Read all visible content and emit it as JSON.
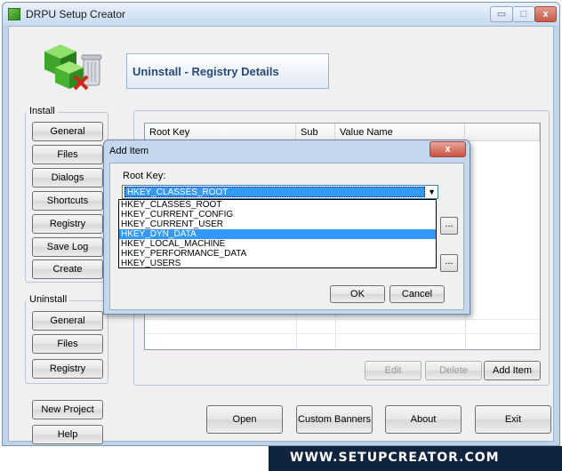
{
  "window": {
    "title": "DRPU Setup Creator",
    "min_glyph": "▭",
    "max_glyph": "□",
    "close_glyph": "x"
  },
  "header": {
    "title": "Uninstall - Registry Details"
  },
  "install": {
    "label": "Install",
    "buttons": [
      "General",
      "Files",
      "Dialogs",
      "Shortcuts",
      "Registry",
      "Save Log",
      "Create"
    ]
  },
  "uninstall": {
    "label": "Uninstall",
    "buttons": [
      "General",
      "Files",
      "Registry"
    ]
  },
  "table": {
    "columns": [
      "Root Key",
      "Sub Key",
      "Value Name"
    ]
  },
  "table_actions": {
    "edit": "Edit",
    "delete": "Delete",
    "add_item": "Add Item"
  },
  "left_actions": {
    "new_project": "New Project",
    "help": "Help"
  },
  "bottom_actions": {
    "open": "Open",
    "custom_banners": "Custom Banners",
    "about": "About",
    "exit": "Exit"
  },
  "footer": {
    "url": "WWW.SETUPCREATOR.COM"
  },
  "dialog": {
    "title": "Add Item",
    "close_glyph": "x",
    "root_key_label": "Root Key:",
    "selected_value": "HKEY_CLASSES_ROOT",
    "options": [
      "HKEY_CLASSES_ROOT",
      "HKEY_CURRENT_CONFIG",
      "HKEY_CURRENT_USER",
      "HKEY_DYN_DATA",
      "HKEY_LOCAL_MACHINE",
      "HKEY_PERFORMANCE_DATA",
      "HKEY_USERS"
    ],
    "highlighted_option": "HKEY_DYN_DATA",
    "browse_glyph": "...",
    "ok": "OK",
    "cancel": "Cancel"
  },
  "colors": {
    "frame": "#bfd3ea",
    "selection": "#3399ff",
    "header_text": "#274a7a",
    "footer_bg": "#10233f",
    "close_button": "#c6533f"
  },
  "icons": [
    "app-icon",
    "setup-boxes-trash-logo-icon",
    "dropdown-arrow-icon"
  ]
}
